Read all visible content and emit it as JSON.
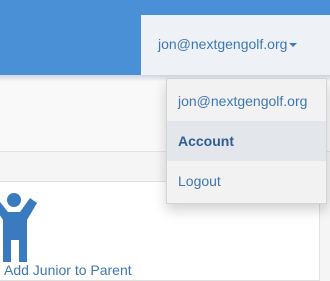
{
  "header": {
    "user_email": "jon@nextgengolf.org"
  },
  "user_menu": {
    "items": [
      {
        "label": "jon@nextgengolf.org"
      },
      {
        "label": "Account",
        "active": true
      },
      {
        "label": "Logout"
      }
    ]
  },
  "card": {
    "icon": "child-icon",
    "text": "Add Junior to Parent"
  },
  "colors": {
    "header_blue": "#4a90d6",
    "link_blue": "#3e78b3",
    "icon_blue": "#3a7bbf"
  }
}
